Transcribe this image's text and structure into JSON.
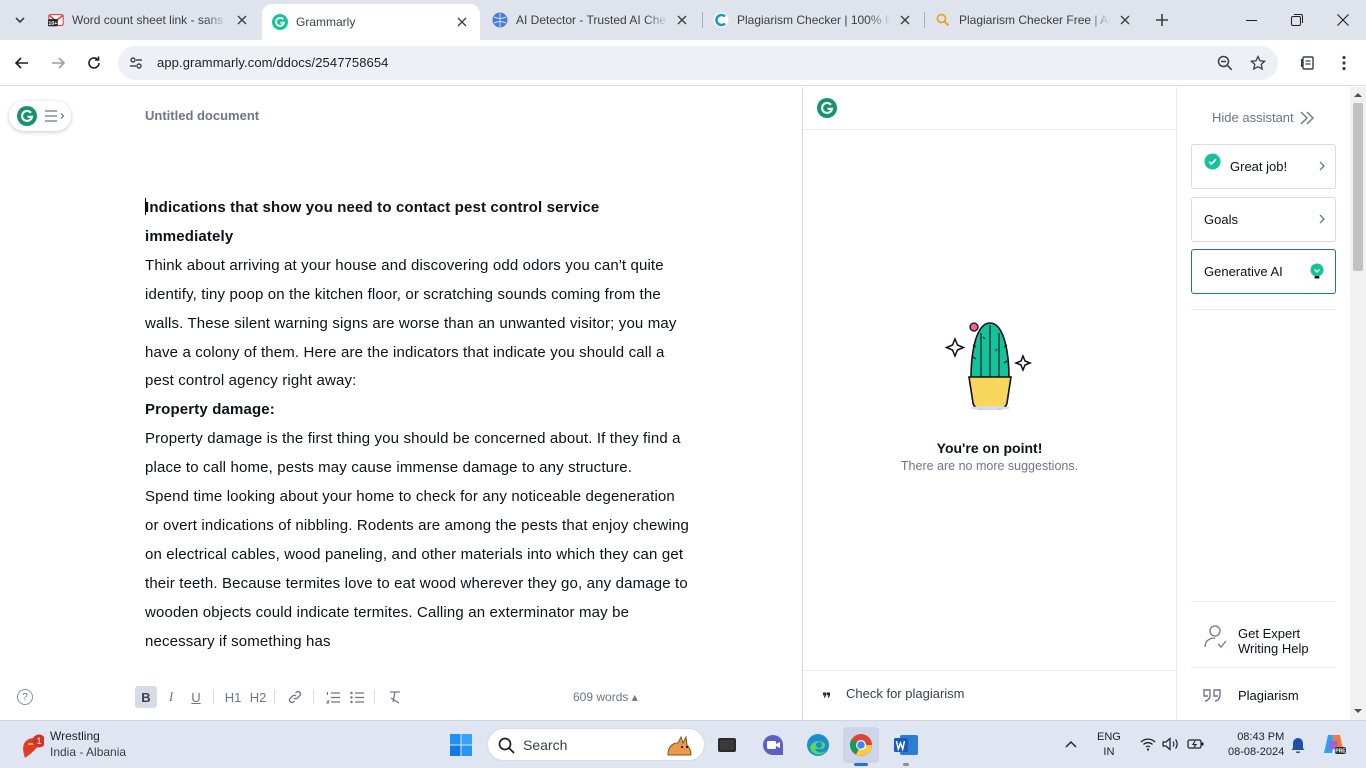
{
  "browser": {
    "tabs": [
      {
        "title": "Word count sheet link - sans",
        "favicon": "gmail-icon",
        "badge": "10+"
      },
      {
        "title": "Grammarly",
        "favicon": "grammarly-icon",
        "active": true
      },
      {
        "title": "AI Detector - Trusted AI Che",
        "favicon": "ai-detector-icon"
      },
      {
        "title": "Plagiarism Checker | 100% F",
        "favicon": "plagiarism-c-icon"
      },
      {
        "title": "Plagiarism Checker Free | Ac",
        "favicon": "search-icon"
      }
    ],
    "url": "app.grammarly.com/ddocs/2547758654"
  },
  "editor": {
    "doc_title": "Untitled document",
    "paragraphs": [
      {
        "text": "Indications that show you need to contact pest control service immediately",
        "heading": true
      },
      {
        "text": "Think about arriving at your house and discovering odd odors you can't quite identify, tiny poop on the kitchen floor, or scratching sounds coming from the walls. These silent warning signs are worse than an unwanted visitor; you may have a colony of them. Here are the indicators that indicate you should call a pest control agency right away:",
        "heading": false
      },
      {
        "text": "Property damage:",
        "heading": true
      },
      {
        "text": "Property damage is the first thing you should be concerned about. If they find a place to call home, pests may cause immense damage to any structure.",
        "heading": false
      },
      {
        "text": "Spend time looking about your home to check for any noticeable degeneration or overt indications of nibbling. Rodents are among the pests that enjoy chewing on electrical cables, wood paneling, and other materials into which they can get their teeth. Because termites love to eat wood wherever they go, any damage to wooden objects could indicate termites. Calling an exterminator may be necessary if something has",
        "heading": false
      }
    ],
    "format": {
      "bold": "B",
      "italic": "I",
      "underline": "U",
      "h1": "H1",
      "h2": "H2",
      "help": "?"
    },
    "word_count": "609 words ▴"
  },
  "assistant": {
    "status_title": "You're on point!",
    "status_sub": "There are no more suggestions.",
    "plagiarism_link": "Check for plagiarism",
    "plagiarism_icon": "❞"
  },
  "sidebar": {
    "hide_label": "Hide assistant",
    "cards": [
      {
        "label": "Great job!",
        "icon": "check-circle-icon"
      },
      {
        "label": "Goals"
      },
      {
        "label": "Generative AI",
        "icon": "bulb-icon"
      }
    ],
    "expert_help": "Get Expert Writing Help",
    "plagiarism": "Plagiarism"
  },
  "taskbar": {
    "weather_badge": "1",
    "weather_title": "Wrestling",
    "weather_sub": "India - Albania",
    "search_label": "Search",
    "lang_top": "ENG",
    "lang_bottom": "IN",
    "time": "08:43 PM",
    "date": "08-08-2024"
  },
  "colors": {
    "grammarly_green": "#15c39a",
    "accent_blue": "#1f6fb2",
    "tab_strip": "#dfe3eb"
  }
}
